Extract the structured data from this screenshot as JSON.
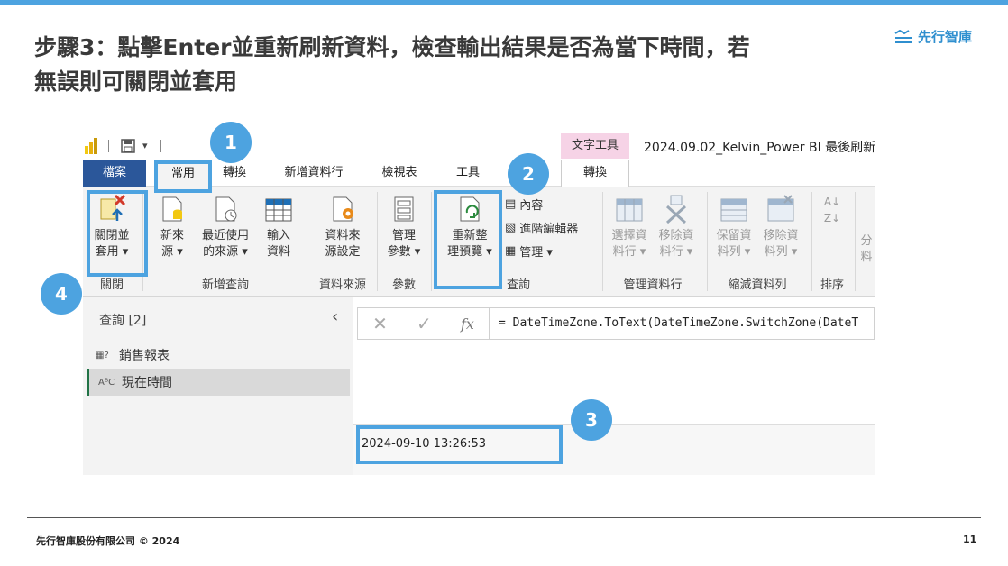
{
  "slide": {
    "title_line1": "步驟3：點擊Enter並重新刷新資料，檢查輸出結果是否為當下時間，若",
    "title_line2": "無誤則可關閉並套用",
    "logo_text": "先行智庫",
    "footer_copyright": "先行智庫股份有限公司 © 2024",
    "page_number": "11"
  },
  "window": {
    "title": "2024.09.02_Kelvin_Power BI 最後刷新",
    "context_tab_group": "文字工具"
  },
  "tabs": [
    {
      "label": "檔案"
    },
    {
      "label": "常用"
    },
    {
      "label": "轉換"
    },
    {
      "label": "新增資料行"
    },
    {
      "label": "檢視表"
    },
    {
      "label": "工具"
    },
    {
      "label": "轉換"
    }
  ],
  "ribbon": {
    "close_apply": {
      "line1": "關閉並",
      "line2": "套用 ▾"
    },
    "new_source": {
      "line1": "新來",
      "line2": "源 ▾"
    },
    "recent_sources": {
      "line1": "最近使用",
      "line2": "的來源 ▾"
    },
    "enter_data": {
      "line1": "輸入",
      "line2": "資料"
    },
    "data_source_settings": {
      "line1": "資料來",
      "line2": "源設定"
    },
    "manage_params": {
      "line1": "管理",
      "line2": "參數 ▾"
    },
    "refresh_preview": {
      "line1": "重新整",
      "line2": "理預覽 ▾"
    },
    "properties": "內容",
    "advanced_editor": "進階編輯器",
    "manage": "管理 ▾",
    "choose_columns": {
      "line1": "選擇資",
      "line2": "料行 ▾"
    },
    "remove_columns": {
      "line1": "移除資",
      "line2": "料行 ▾"
    },
    "keep_rows": {
      "line1": "保留資",
      "line2": "料列 ▾"
    },
    "remove_rows": {
      "line1": "移除資",
      "line2": "料列 ▾"
    },
    "split": {
      "line1": "分",
      "line2": "料"
    },
    "groups": {
      "close": "關閉",
      "new_query": "新增查詢",
      "data_sources": "資料來源",
      "parameters": "參數",
      "query": "查詢",
      "manage_columns": "管理資料行",
      "reduce_rows": "縮減資料列",
      "sort": "排序"
    }
  },
  "queries_pane": {
    "title": "查詢 [2]",
    "items": [
      {
        "icon": "table-icon",
        "label": "銷售報表"
      },
      {
        "icon": "abc-icon",
        "label": "現在時間"
      }
    ]
  },
  "formula_bar": {
    "formula": "= DateTimeZone.ToText(DateTimeZone.SwitchZone(DateT",
    "fx_label": "fx"
  },
  "result": {
    "value": "2024-09-10 13:26:53"
  },
  "badges": [
    "1",
    "2",
    "3",
    "4"
  ],
  "colors": {
    "accent": "#4da3e0",
    "file_tab": "#2b579a",
    "context_tab": "#f6d3e6"
  }
}
